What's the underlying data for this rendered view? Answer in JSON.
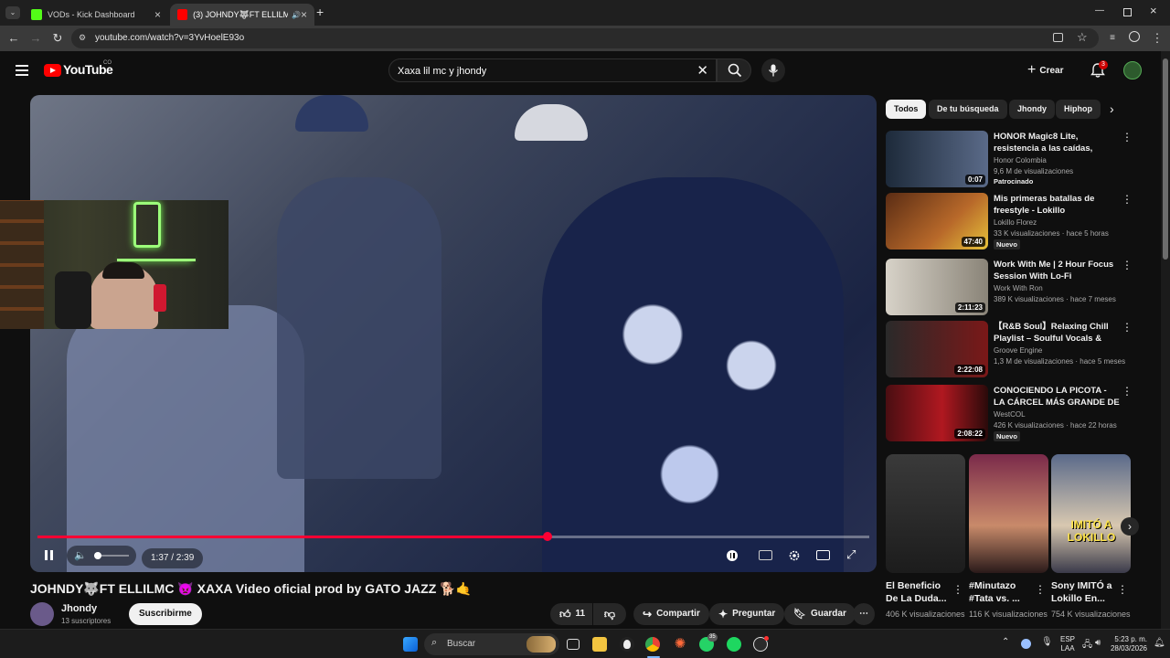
{
  "browser": {
    "tabs": [
      {
        "title": "VODs - Kick Dashboard",
        "active": false
      },
      {
        "title": "(3) JOHNDY🐺FT ELLILMC",
        "active": true
      }
    ],
    "url": "youtube.com/watch?v=3YvHoelE93o"
  },
  "header": {
    "logo": "YouTube",
    "country": "CO",
    "search_query": "Xaxa lil mc y jhondy",
    "create_label": "Crear",
    "notification_count": "3"
  },
  "player": {
    "progress": 0.613,
    "time": "1:37 / 2:39"
  },
  "video": {
    "title": "JOHNDY🐺FT ELLILMC 👿 XAXA Video oficial prod by GATO JAZZ 🐕🤙",
    "channel": "Jhondy",
    "subscribers": "13 suscriptores",
    "subscribe_label": "Suscribirme",
    "likes": "11",
    "share_label": "Compartir",
    "ask_label": "Preguntar",
    "save_label": "Guardar"
  },
  "chips": [
    "Todos",
    "De tu búsqueda",
    "Jhondy",
    "Hiphop"
  ],
  "recommendations": [
    {
      "title": "HONOR Magic8 Lite, resistencia a las caídas, protección IP69K...",
      "channel": "Honor Colombia",
      "meta": "9,6 M de visualizaciones",
      "badge": "Patrocinado",
      "duration": "0:07",
      "thumb_color": "#1d2a3a"
    },
    {
      "title": "Mis primeras batallas de freestyle - Lokillo",
      "channel": "Lokillo Florez",
      "meta": "33 K visualizaciones · hace 5 horas",
      "badge": "Nuevo",
      "duration": "47:40",
      "thumb_color": "#5a2c14"
    },
    {
      "title": "Work With Me | 2 Hour Focus Session With Lo-Fi Productivit...",
      "channel": "Work With Ron",
      "meta": "389 K visualizaciones · hace 7 meses",
      "badge": "",
      "duration": "2:11:23",
      "thumb_color": "#b8b2a6"
    },
    {
      "title": "【R&B Soul】Relaxing Chill Playlist – Soulful Vocals & Dee...",
      "channel": "Groove Engine",
      "meta": "1,3 M de visualizaciones · hace 5 meses",
      "badge": "",
      "duration": "2:22:08",
      "thumb_color": "#3a1414"
    },
    {
      "title": "CONOCIENDO LA PICOTA - LA CÁRCEL MÁS GRANDE DE ...",
      "channel": "WestCOL",
      "meta": "426 K visualizaciones · hace 22 horas",
      "badge": "Nuevo",
      "duration": "2:08:22",
      "thumb_color": "#4a0e12"
    }
  ],
  "shorts": [
    {
      "title": "El Beneficio De La Duda...",
      "views": "406 K visualizaciones",
      "color": "#2b2b2b"
    },
    {
      "title": "#Minutazo #Tata vs. ...",
      "views": "116 K visualizaciones",
      "color": "#5c1f3a"
    },
    {
      "title": "Sony IMITÓ a Lokillo En...",
      "views": "754 K visualizaciones",
      "color": "#3b4a6a",
      "overlay": "IMITÓ A LOKILLO"
    }
  ],
  "taskbar": {
    "search_label": "Buscar",
    "lang": "ESP",
    "layout": "LAA",
    "time": "5:23 p. m.",
    "date": "28/03/2026",
    "whatsapp_badge": "35"
  },
  "colors": {
    "accent": "#ff0033",
    "background": "#0f0f0f"
  }
}
